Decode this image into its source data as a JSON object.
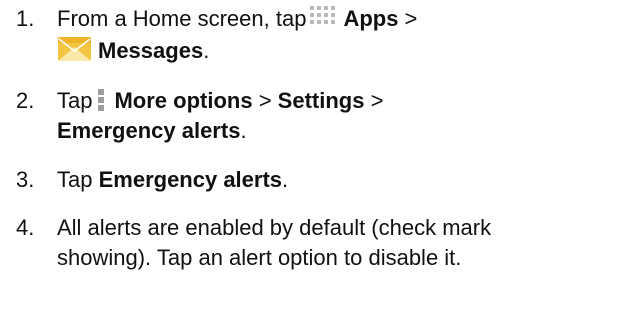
{
  "steps": [
    {
      "number": "1.",
      "line1": {
        "pre": "From a Home screen, tap",
        "bold": "Apps",
        "post": " >"
      },
      "line2": {
        "bold": "Messages",
        "post": "."
      },
      "icons": [
        "apps-grid-icon",
        "messages-envelope-icon"
      ]
    },
    {
      "number": "2.",
      "line1": {
        "pre": "Tap",
        "bold1": "More options",
        "mid": " > ",
        "bold2": "Settings",
        "post": " >"
      },
      "line2": {
        "bold": "Emergency alerts",
        "post": "."
      },
      "icons": [
        "more-options-icon"
      ]
    },
    {
      "number": "3.",
      "line1": {
        "pre": "Tap ",
        "bold": "Emergency alerts",
        "post": "."
      }
    },
    {
      "number": "4.",
      "line1": {
        "text": "All alerts are enabled by default (check mark"
      },
      "line2": {
        "text": "showing). Tap an alert option to disable it."
      }
    }
  ],
  "colors": {
    "text": "#111111",
    "apps_icon": "#b9b9b9",
    "envelope_body": "#f4c542",
    "envelope_flap": "#fbe7a8",
    "more_icon": "#9c9c9c"
  }
}
